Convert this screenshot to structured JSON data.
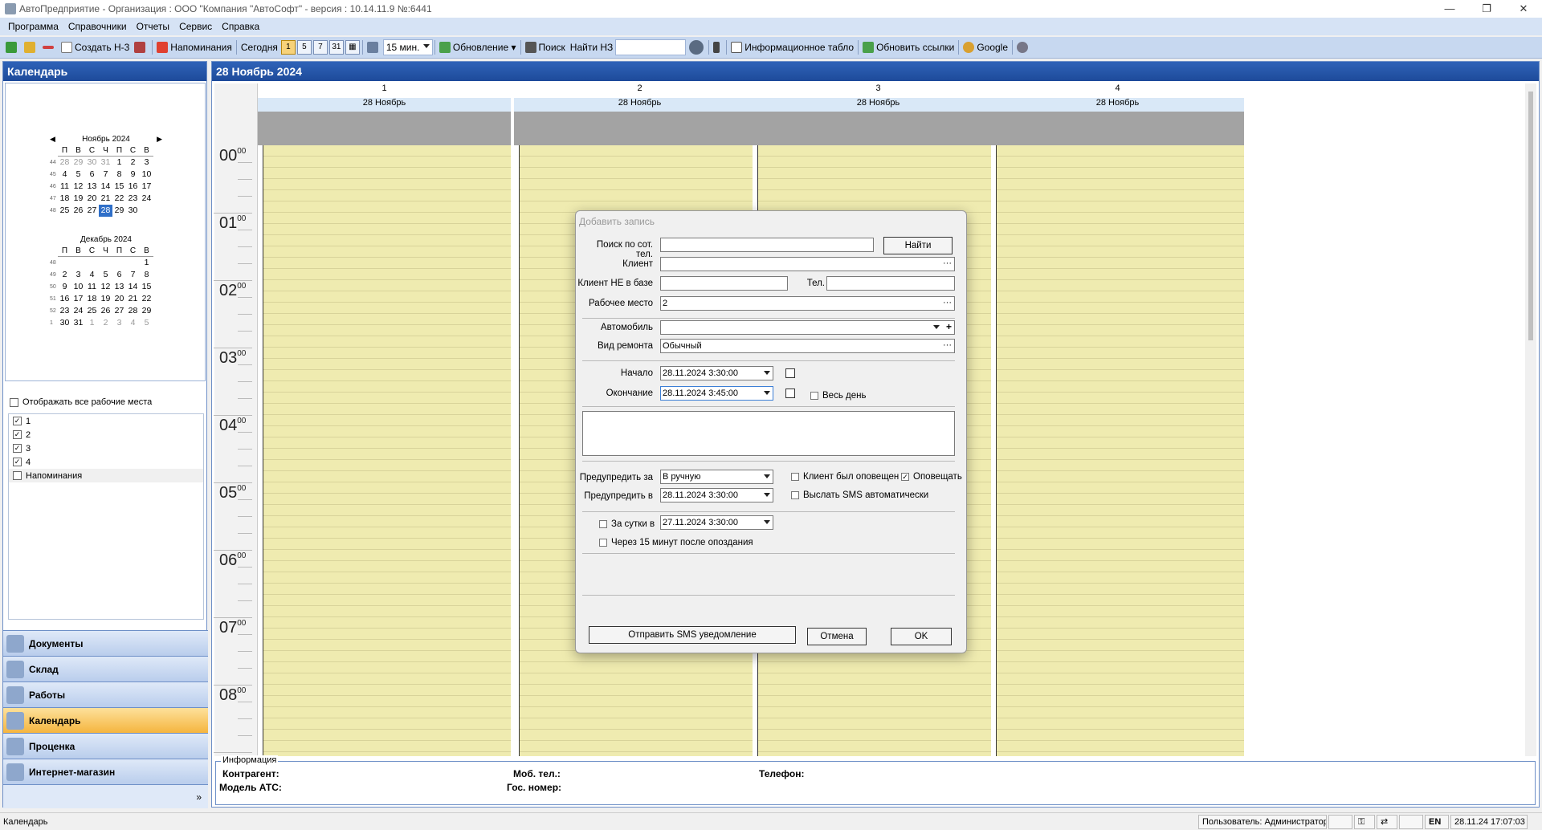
{
  "window": {
    "title": "АвтоПредприятие  -  Организация : ООО \"Компания \"АвтоСофт\" - версия : 10.14.11.9   №:6441",
    "minimize": "—",
    "maximize": "❐",
    "close": "✕"
  },
  "menu": [
    "Программа",
    "Справочники",
    "Отчеты",
    "Сервис",
    "Справка"
  ],
  "toolbar": {
    "create": "Создать Н-3",
    "reminders": "Напоминания",
    "today": "Сегодня",
    "views": [
      "1",
      "5",
      "7",
      "31",
      "▦"
    ],
    "interval": "15 мин.",
    "update": "Обновление",
    "search": "Поиск",
    "find_n3": "Найти НЗ",
    "info_board": "Информационное табло",
    "refresh_links": "Обновить ссылки",
    "google": "Google"
  },
  "left_panel": {
    "title": "Календарь",
    "cal1": {
      "month": "Ноябрь 2024",
      "days": [
        "П",
        "В",
        "С",
        "Ч",
        "П",
        "С",
        "В"
      ],
      "weeks": [
        {
          "n": "44",
          "d": [
            "28",
            "29",
            "30",
            "31",
            "1",
            "2",
            "3"
          ]
        },
        {
          "n": "45",
          "d": [
            "4",
            "5",
            "6",
            "7",
            "8",
            "9",
            "10"
          ]
        },
        {
          "n": "46",
          "d": [
            "11",
            "12",
            "13",
            "14",
            "15",
            "16",
            "17"
          ]
        },
        {
          "n": "47",
          "d": [
            "18",
            "19",
            "20",
            "21",
            "22",
            "23",
            "24"
          ]
        },
        {
          "n": "48",
          "d": [
            "25",
            "26",
            "27",
            "28",
            "29",
            "30",
            ""
          ]
        }
      ]
    },
    "cal2": {
      "month": "Декабрь 2024",
      "days": [
        "П",
        "В",
        "С",
        "Ч",
        "П",
        "С",
        "В"
      ],
      "weeks": [
        {
          "n": "48",
          "d": [
            "",
            "",
            "",
            "",
            "",
            "",
            "1"
          ]
        },
        {
          "n": "49",
          "d": [
            "2",
            "3",
            "4",
            "5",
            "6",
            "7",
            "8"
          ]
        },
        {
          "n": "50",
          "d": [
            "9",
            "10",
            "11",
            "12",
            "13",
            "14",
            "15"
          ]
        },
        {
          "n": "51",
          "d": [
            "16",
            "17",
            "18",
            "19",
            "20",
            "21",
            "22"
          ]
        },
        {
          "n": "52",
          "d": [
            "23",
            "24",
            "25",
            "26",
            "27",
            "28",
            "29"
          ]
        },
        {
          "n": "1",
          "d": [
            "30",
            "31",
            "1",
            "2",
            "3",
            "4",
            "5"
          ]
        }
      ]
    },
    "show_all_label": "Отображать все рабочие места",
    "workplaces": [
      {
        "label": "1",
        "checked": true
      },
      {
        "label": "2",
        "checked": true
      },
      {
        "label": "3",
        "checked": true
      },
      {
        "label": "4",
        "checked": true
      },
      {
        "label": "Напоминания",
        "checked": false
      }
    ],
    "nav": [
      "Документы",
      "Склад",
      "Работы",
      "Календарь",
      "Проценка",
      "Интернет-магазин"
    ],
    "nav_more": "»"
  },
  "main": {
    "title": "28 Ноябрь 2024",
    "columns": [
      {
        "num": "1",
        "date": "28 Ноябрь"
      },
      {
        "num": "2",
        "date": "28 Ноябрь"
      },
      {
        "num": "3",
        "date": "28 Ноябрь"
      },
      {
        "num": "4",
        "date": "28 Ноябрь"
      }
    ],
    "hours": [
      "00",
      "01",
      "02",
      "03",
      "04",
      "05",
      "06",
      "07",
      "08"
    ],
    "minutes": "00",
    "info": {
      "legend": "Информация",
      "contractor": "Контрагент:",
      "mobile": "Моб. тел.:",
      "phone": "Телефон:",
      "model": "Модель АТС:",
      "plate": "Гос. номер:"
    }
  },
  "dialog": {
    "title": "Добавить запись",
    "search_phone_label": "Поиск по сот. тел.",
    "search_phone_value": "",
    "find_button": "Найти",
    "client_label": "Клиент",
    "client_value": "",
    "client_not_in_db_label": "Клиент НЕ в базе",
    "client_not_in_db_value": "",
    "tel_label": "Тел.",
    "tel_value": "",
    "workplace_label": "Рабочее место",
    "workplace_value": "2",
    "car_label": "Автомобиль",
    "car_value": "",
    "repair_type_label": "Вид ремонта",
    "repair_type_value": "Обычный",
    "start_label": "Начало",
    "start_value": "28.11.2024 3:30:00",
    "end_label": "Окончание",
    "end_value": "28.11.2024 3:45:00",
    "all_day_label": "Весь день",
    "warn_for_label": "Предупредить за",
    "warn_for_value": "В ручную",
    "client_notified_label": "Клиент был оповещен",
    "notify_label": "Оповещать",
    "warn_at_label": "Предупредить в",
    "warn_at_value": "28.11.2024 3:30:00",
    "send_sms_auto_label": "Выслать SMS автоматически",
    "day_before_label": "За сутки в",
    "day_before_value": "27.11.2024 3:30:00",
    "late_15_label": "Через 15 минут после опоздания",
    "send_sms_button": "Отправить SMS уведомление",
    "cancel_button": "Отмена",
    "ok_button": "OK"
  },
  "statusbar": {
    "left": "Календарь",
    "user": "Пользователь: Администратор",
    "lang": "EN",
    "datetime": "28.11.24  17:07:03"
  },
  "colors": {
    "accent": "#1d4a9a",
    "slot": "#efebb0",
    "selected_day": "#2f6fc8",
    "active_nav": "#f5b53f"
  }
}
